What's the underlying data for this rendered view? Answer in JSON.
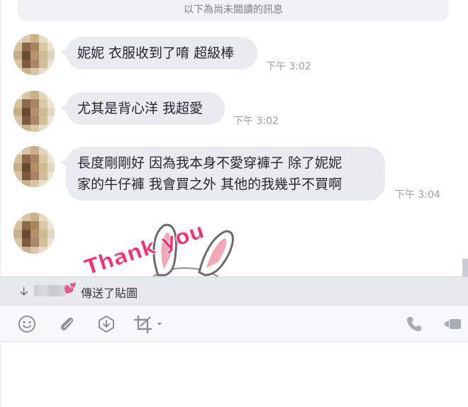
{
  "chat": {
    "unread_divider": "以下為尚未閱讀的訊息",
    "messages": [
      {
        "text": "妮妮 衣服收到了唷 超級棒",
        "time": "下午 3:02"
      },
      {
        "text": "尤其是背心洋 我超愛",
        "time": "下午 3:02"
      },
      {
        "text_line1": "長度剛剛好 因為我本身不愛穿褲子 除了妮妮",
        "text_line2": "家的牛仔褲 我會買之外 其他的我幾乎不買啊",
        "time": "下午 3:04"
      }
    ],
    "sticker_text": "Thank you"
  },
  "notification": {
    "arrow_icon": "down-arrow-icon",
    "text": "傳送了貼圖"
  },
  "toolbar": {
    "icons": [
      "emoji-icon",
      "attachment-icon",
      "keep-icon",
      "screenshot-crop-icon",
      "call-icon",
      "video-call-icon"
    ]
  },
  "colors": {
    "bubble": "#e8ebef",
    "unread_bg": "#f0f2f5",
    "sticker_pink": "#ff2d6f",
    "icon_gray": "#8a9099"
  }
}
